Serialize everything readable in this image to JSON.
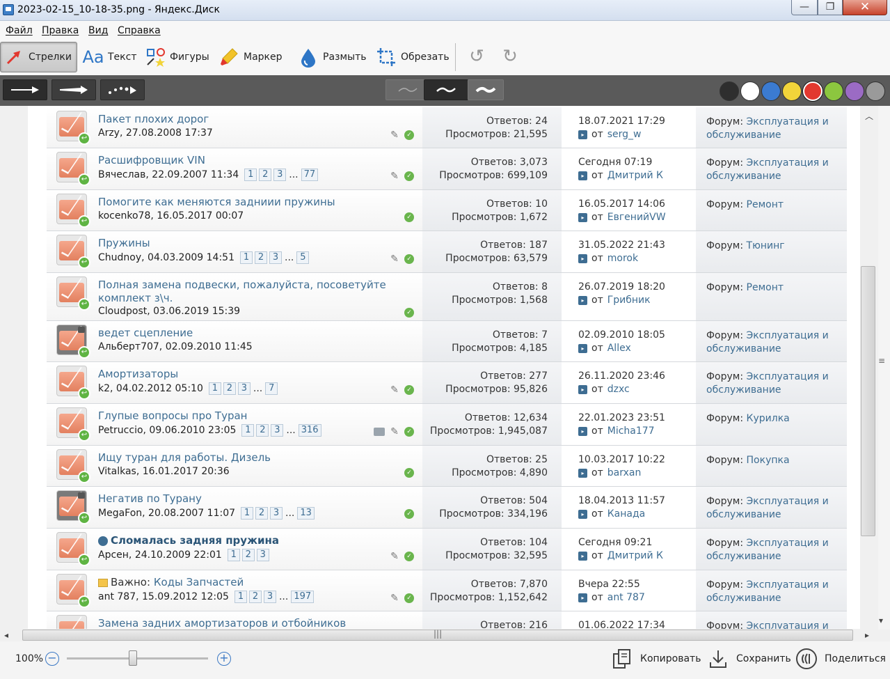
{
  "window": {
    "title": "2023-02-15_10-18-35.png - Яндекс.Диск",
    "min": "—",
    "max": "❐",
    "close": "✕"
  },
  "menu": [
    "Файл",
    "Правка",
    "Вид",
    "Справка"
  ],
  "tools": [
    {
      "label": "Стрелки",
      "icon": "arrow-icon",
      "active": true
    },
    {
      "label": "Текст",
      "icon": "text-icon"
    },
    {
      "label": "Фигуры",
      "icon": "shapes-icon"
    },
    {
      "label": "Маркер",
      "icon": "marker-icon"
    },
    {
      "label": "Размыть",
      "icon": "blur-drop-icon"
    },
    {
      "label": "Обрезать",
      "icon": "crop-icon"
    }
  ],
  "colors": [
    "#2e2e2e",
    "#ffffff",
    "#3b7bd1",
    "#f2d43a",
    "#e2382f",
    "#8cc63f",
    "#9b6bc4",
    "#9a9a9a"
  ],
  "selected_color": "#e2382f",
  "topics": [
    {
      "title": "Пакет плохих дорог",
      "meta": "Arzy, 27.08.2008 17:37",
      "pages": [],
      "pin": true,
      "ok": true,
      "tag": false,
      "replies": "Ответов: 24",
      "views": "Просмотров: 21,595",
      "last_date": "18.07.2021 17:29",
      "last_user": "serg_w",
      "forum_label": "Форум:",
      "forum": "Эксплуатация и обслуживание",
      "locked": false
    },
    {
      "title": "Расшифровщик VIN",
      "meta": "Вячеслав, 22.09.2007 11:34",
      "pages": [
        "1",
        "2",
        "3",
        "...",
        "77"
      ],
      "pin": true,
      "ok": true,
      "tag": false,
      "replies": "Ответов: 3,073",
      "views": "Просмотров: 699,109",
      "last_date": "Сегодня 07:19",
      "last_user": "Дмитрий К",
      "forum_label": "Форум:",
      "forum": "Эксплуатация и обслуживание",
      "locked": false
    },
    {
      "title": "Помогите как меняются задниии пружины",
      "meta": "kocenko78, 16.05.2017 00:07",
      "pages": [],
      "pin": false,
      "ok": true,
      "tag": false,
      "replies": "Ответов: 10",
      "views": "Просмотров: 1,672",
      "last_date": "16.05.2017 14:06",
      "last_user": "ЕвгенийVW",
      "forum_label": "Форум:",
      "forum": "Ремонт",
      "locked": false
    },
    {
      "title": "Пружины",
      "meta": "Chudnoy, 04.03.2009 14:51",
      "pages": [
        "1",
        "2",
        "3",
        "...",
        "5"
      ],
      "pin": true,
      "ok": true,
      "tag": false,
      "replies": "Ответов: 187",
      "views": "Просмотров: 63,579",
      "last_date": "31.05.2022 21:43",
      "last_user": "morok",
      "forum_label": "Форум:",
      "forum": "Тюнинг",
      "locked": false
    },
    {
      "title": "Полная замена подвески, пожалуйста, посоветуйте комплект з\\ч.",
      "meta": "Cloudpost, 03.06.2019 15:39",
      "pages": [],
      "pin": false,
      "ok": true,
      "tag": false,
      "replies": "Ответов: 8",
      "views": "Просмотров: 1,568",
      "last_date": "26.07.2019 18:20",
      "last_user": "Грибник",
      "forum_label": "Форум:",
      "forum": "Ремонт",
      "locked": false
    },
    {
      "title": "ведет сцепление",
      "meta": "Альберт707, 02.09.2010 11:45",
      "pages": [],
      "pin": false,
      "ok": false,
      "tag": false,
      "replies": "Ответов: 7",
      "views": "Просмотров: 4,185",
      "last_date": "02.09.2010 18:05",
      "last_user": "Allex",
      "forum_label": "Форум:",
      "forum": "Эксплуатация и обслуживание",
      "locked": true
    },
    {
      "title": "Амортизаторы",
      "meta": "k2, 04.02.2012 05:10",
      "pages": [
        "1",
        "2",
        "3",
        "...",
        "7"
      ],
      "pin": true,
      "ok": true,
      "tag": false,
      "replies": "Ответов: 277",
      "views": "Просмотров: 95,826",
      "last_date": "26.11.2020 23:46",
      "last_user": "dzxc",
      "forum_label": "Форум:",
      "forum": "Эксплуатация и обслуживание",
      "locked": false
    },
    {
      "title": "Глупые вопросы про Туран",
      "meta": "Petruccio, 09.06.2010 23:05",
      "pages": [
        "1",
        "2",
        "3",
        "...",
        "316"
      ],
      "pin": true,
      "ok": true,
      "tag": true,
      "replies": "Ответов: 12,634",
      "views": "Просмотров: 1,945,087",
      "last_date": "22.01.2023 23:51",
      "last_user": "Micha177",
      "forum_label": "Форум:",
      "forum": "Курилка",
      "locked": false
    },
    {
      "title": "Ищу туран для работы. Дизель",
      "meta": "Vitalkas, 16.01.2017 20:36",
      "pages": [],
      "pin": false,
      "ok": true,
      "tag": false,
      "replies": "Ответов: 25",
      "views": "Просмотров: 4,890",
      "last_date": "10.03.2017 10:22",
      "last_user": "barxan",
      "forum_label": "Форум:",
      "forum": "Покупка",
      "locked": false
    },
    {
      "title": "Негатив по Турану",
      "meta": "MegaFon, 20.08.2007 11:07",
      "pages": [
        "1",
        "2",
        "3",
        "...",
        "13"
      ],
      "pin": false,
      "ok": true,
      "tag": false,
      "replies": "Ответов: 504",
      "views": "Просмотров: 334,196",
      "last_date": "18.04.2013 11:57",
      "last_user": "Канада",
      "forum_label": "Форум:",
      "forum": "Эксплуатация и обслуживание",
      "locked": true
    },
    {
      "title": "Сломалась задняя пружина",
      "meta": "Арсен, 24.10.2009 22:01",
      "pages": [
        "1",
        "2",
        "3"
      ],
      "pin": true,
      "ok": true,
      "tag": false,
      "bold": true,
      "poll": true,
      "replies": "Ответов: 104",
      "views": "Просмотров: 32,595",
      "last_date": "Сегодня 09:21",
      "last_user": "Дмитрий К",
      "forum_label": "Форум:",
      "forum": "Эксплуатация и обслуживание",
      "locked": false
    },
    {
      "title": "Коды Запчастей",
      "prefix": "Важно:",
      "meta": "ant 787, 15.09.2012 12:05",
      "pages": [
        "1",
        "2",
        "3",
        "...",
        "197"
      ],
      "pin": true,
      "ok": true,
      "tag": false,
      "replies": "Ответов: 7,870",
      "views": "Просмотров: 1,152,642",
      "last_date": "Вчера 22:55",
      "last_user": "ant 787",
      "forum_label": "Форум:",
      "forum": "Эксплуатация и обслуживание",
      "locked": false
    },
    {
      "title": "Замена задних амортизаторов и отбойников",
      "meta": "",
      "pages": [],
      "pin": false,
      "ok": false,
      "tag": false,
      "replies": "Ответов: 216",
      "views": "",
      "last_date": "01.06.2022 17:34",
      "last_user": "",
      "forum_label": "Форум:",
      "forum": "Эксплуатация и",
      "locked": false
    }
  ],
  "from_label": "от",
  "status": {
    "zoom": "100%",
    "zoom_out": "−",
    "zoom_in": "+",
    "zoom_level": 0.47,
    "copy": "Копировать",
    "save": "Сохранить",
    "share": "Поделиться"
  }
}
